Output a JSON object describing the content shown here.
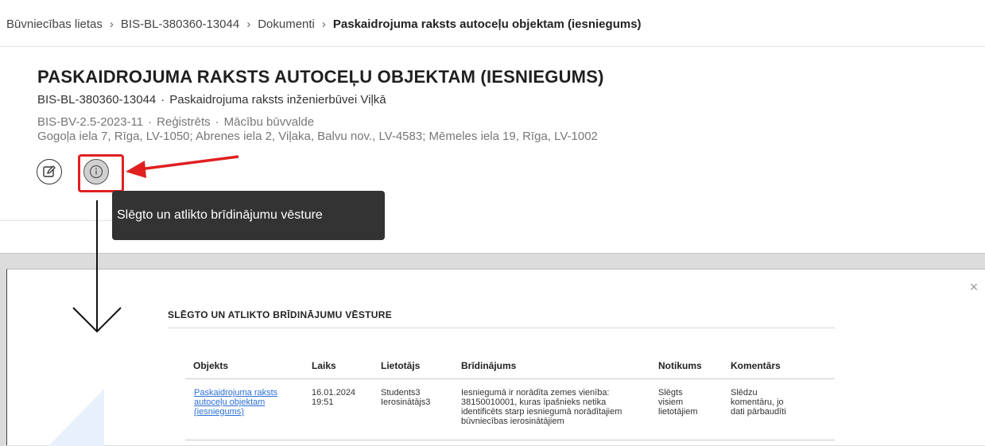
{
  "breadcrumb": {
    "item1": "Būvniecības lietas",
    "item2": "BIS-BL-380360-13044",
    "item3": "Dokumenti",
    "current": "Paskaidrojuma raksts autoceļu objektam (iesniegums)",
    "separator": "›"
  },
  "document": {
    "title": "PASKAIDROJUMA RAKSTS AUTOCEĻU OBJEKTAM (IESNIEGUMS)",
    "case_id": "BIS-BL-380360-13044",
    "case_desc": "Paskaidrojuma raksts inženierbūvei Viļkā",
    "reg_number": "BIS-BV-2.5-2023-11",
    "status": "Reģistrēts",
    "authority": "Mācību būvvalde",
    "addresses": "Gogoļa iela 7, Rīga, LV-1050; Abrenes iela 2, Viļaka, Balvu nov., LV-4583; Mēmeles iela 19, Rīga, LV-1002",
    "separator_dot": "·"
  },
  "buttons": {
    "edit_icon": "edit-icon",
    "info_icon": "info-icon"
  },
  "tooltip": {
    "text": "Slēgto un atlikto brīdinājumu vēsture"
  },
  "modal": {
    "title": "SLĒGTO UN ATLIKTO BRĪDINĀJUMU VĒSTURE",
    "close_icon": "×",
    "columns": [
      "Objekts",
      "Laiks",
      "Lietotājs",
      "Brīdinājums",
      "Notikums",
      "Komentārs"
    ],
    "rows": [
      {
        "object": "Paskaidrojuma raksts autoceļu objektam (iesniegums)",
        "time": "16.01.2024 19:51",
        "user": "Students3 Ierosinātājs3",
        "warning": "Iesniegumā ir norādīta zemes vienība: 38150010001, kuras īpašnieks netika identificēts starp iesniegumā norādītajiem būvniecības ierosinātājiem",
        "event": "Slēgts visiem lietotājiem",
        "comment": "Slēdzu komentāru, jo dati pārbaudīti"
      }
    ]
  },
  "colors": {
    "highlight": "#e02020",
    "tooltip_bg": "#333333",
    "link": "#2a6fd6"
  }
}
